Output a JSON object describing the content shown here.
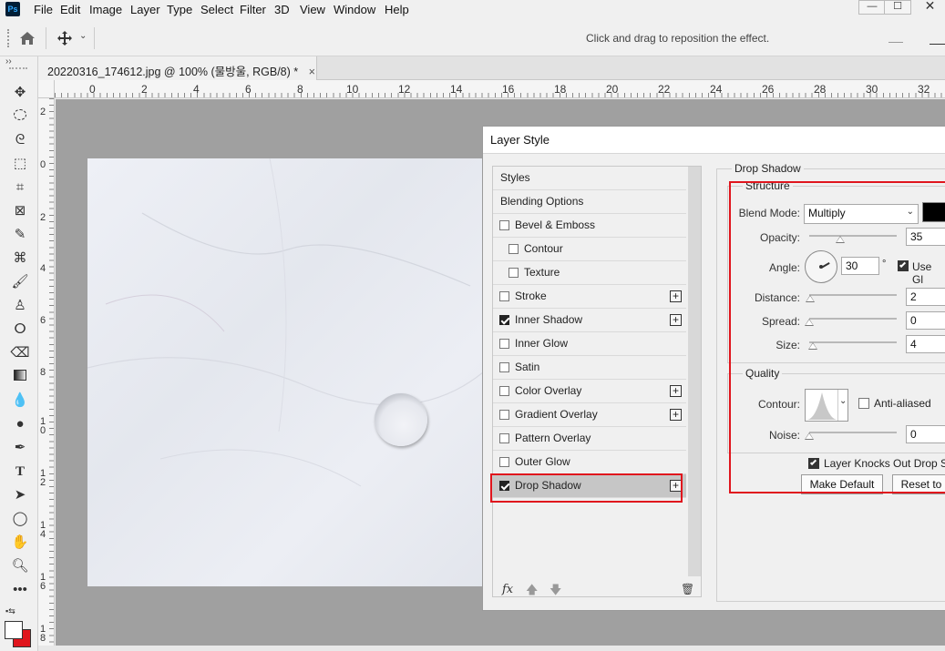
{
  "menu": {
    "app_icon": "Ps",
    "items": [
      "File",
      "Edit",
      "Image",
      "Layer",
      "Type",
      "Select",
      "Filter",
      "3D",
      "View",
      "Window",
      "Help"
    ],
    "window_controls": [
      "—",
      "☐",
      "✕"
    ]
  },
  "options_bar": {
    "hint": "Click and drag to reposition the effect."
  },
  "document_tab": {
    "title": "20220316_174612.jpg @ 100% (물방울, RGB/8) *",
    "close": "×"
  },
  "ruler_top": [
    "0",
    "2",
    "4",
    "6",
    "8",
    "10",
    "12",
    "14",
    "16",
    "18",
    "20",
    "22",
    "24",
    "26",
    "28",
    "30",
    "32"
  ],
  "ruler_left": [
    "2",
    "0",
    "2",
    "4",
    "6",
    "8",
    "1\n0",
    "1\n2",
    "1\n4",
    "1\n6",
    "1\n8"
  ],
  "status": "100%",
  "dialog": {
    "title": "Layer Style",
    "styles": [
      {
        "label": "Styles",
        "checkbox": false,
        "checked": false,
        "plus": false,
        "indent": false
      },
      {
        "label": "Blending Options",
        "checkbox": false,
        "checked": false,
        "plus": false,
        "indent": false
      },
      {
        "label": "Bevel & Emboss",
        "checkbox": true,
        "checked": false,
        "plus": false,
        "indent": false
      },
      {
        "label": "Contour",
        "checkbox": true,
        "checked": false,
        "plus": false,
        "indent": true
      },
      {
        "label": "Texture",
        "checkbox": true,
        "checked": false,
        "plus": false,
        "indent": true
      },
      {
        "label": "Stroke",
        "checkbox": true,
        "checked": false,
        "plus": true,
        "indent": false
      },
      {
        "label": "Inner Shadow",
        "checkbox": true,
        "checked": true,
        "plus": true,
        "indent": false
      },
      {
        "label": "Inner Glow",
        "checkbox": true,
        "checked": false,
        "plus": false,
        "indent": false
      },
      {
        "label": "Satin",
        "checkbox": true,
        "checked": false,
        "plus": false,
        "indent": false
      },
      {
        "label": "Color Overlay",
        "checkbox": true,
        "checked": false,
        "plus": true,
        "indent": false
      },
      {
        "label": "Gradient Overlay",
        "checkbox": true,
        "checked": false,
        "plus": true,
        "indent": false
      },
      {
        "label": "Pattern Overlay",
        "checkbox": true,
        "checked": false,
        "plus": false,
        "indent": false
      },
      {
        "label": "Outer Glow",
        "checkbox": true,
        "checked": false,
        "plus": false,
        "indent": false
      },
      {
        "label": "Drop Shadow",
        "checkbox": true,
        "checked": true,
        "plus": true,
        "indent": false,
        "selected": true
      }
    ],
    "footer_icons": [
      "fx-icon",
      "arrow-up-icon",
      "arrow-down-icon",
      "trash-icon"
    ],
    "fx_label": "fx",
    "drop_shadow": {
      "section_title": "Drop Shadow",
      "structure_title": "Structure",
      "blend_mode_label": "Blend Mode:",
      "blend_mode_value": "Multiply",
      "shadow_color": "#000000",
      "opacity_label": "Opacity:",
      "opacity_value": "35",
      "angle_label": "Angle:",
      "angle_value": "30",
      "degree_symbol": "°",
      "use_global_label": "Use Gl",
      "use_global_checked": true,
      "distance_label": "Distance:",
      "distance_value": "2",
      "spread_label": "Spread:",
      "spread_value": "0",
      "size_label": "Size:",
      "size_value": "4",
      "quality_title": "Quality",
      "contour_label": "Contour:",
      "anti_aliased_label": "Anti-aliased",
      "anti_aliased_checked": false,
      "noise_label": "Noise:",
      "noise_value": "0",
      "knockout_label": "Layer Knocks Out Drop Sh",
      "knockout_checked": true,
      "make_default_label": "Make Default",
      "reset_label": "Reset to"
    }
  },
  "highlight_color": "#e0151d"
}
